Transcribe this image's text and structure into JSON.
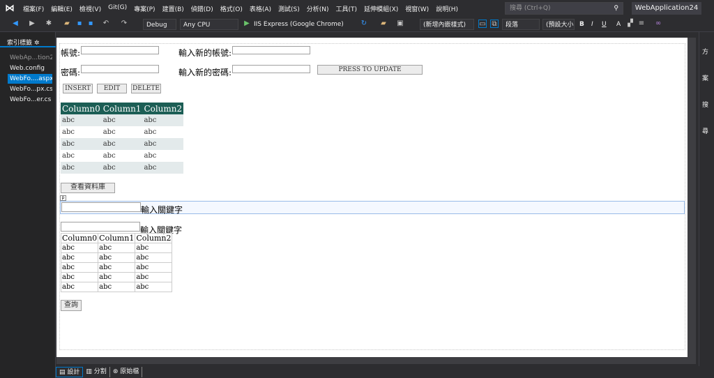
{
  "menubar": {
    "items": [
      "檔案(F)",
      "編輯(E)",
      "檢視(V)",
      "Git(G)",
      "專案(P)",
      "建置(B)",
      "偵錯(D)",
      "格式(O)",
      "表格(A)",
      "測試(S)",
      "分析(N)",
      "工具(T)",
      "延伸模組(X)",
      "視窗(W)",
      "說明(H)"
    ],
    "search_placeholder": "搜尋 (Ctrl+Q)",
    "solution_title": "WebApplication24"
  },
  "toolbar": {
    "config": "Debug",
    "platform": "Any CPU",
    "run_target": "IIS Express (Google Chrome)",
    "doc_mode": "(新增內嵌樣式)",
    "block_format": "段落",
    "font_size": "(預設大小)",
    "bold": "B",
    "italic": "I",
    "underline": "U",
    "font_color": "A"
  },
  "left_panel": {
    "title": "索引標籤",
    "items": [
      {
        "label": "WebAp...tion24",
        "kind": "project"
      },
      {
        "label": "Web.config",
        "kind": "file"
      },
      {
        "label": "WebFo....aspx",
        "kind": "selected"
      },
      {
        "label": "WebFo...px.cs",
        "kind": "file"
      },
      {
        "label": "WebFo...er.cs",
        "kind": "file"
      }
    ]
  },
  "right_panel": {
    "labels": [
      "方案",
      "搜尋"
    ]
  },
  "form": {
    "account_label": "帳號:",
    "new_account_label": "輸入新的帳號:",
    "password_label": "密碼:",
    "new_password_label": "輸入新的密碼:",
    "update_button": "PRESS TO UPDATE",
    "insert_button": "INSERT",
    "edit_button": "EDIT",
    "delete_button": "DELETE",
    "grid1": {
      "columns": [
        "Column0",
        "Column1",
        "Column2"
      ],
      "rows": [
        [
          "abc",
          "abc",
          "abc"
        ],
        [
          "abc",
          "abc",
          "abc"
        ],
        [
          "abc",
          "abc",
          "abc"
        ],
        [
          "abc",
          "abc",
          "abc"
        ],
        [
          "abc",
          "abc",
          "abc"
        ]
      ]
    },
    "view_db_button": "查看資料庫",
    "p_tag": "p",
    "keyword_label_1": "輸入關鍵字",
    "keyword_label_2": "輸入關鍵字",
    "grid2": {
      "columns": [
        "Column0",
        "Column1",
        "Column2"
      ],
      "rows": [
        [
          "abc",
          "abc",
          "abc"
        ],
        [
          "abc",
          "abc",
          "abc"
        ],
        [
          "abc",
          "abc",
          "abc"
        ],
        [
          "abc",
          "abc",
          "abc"
        ],
        [
          "abc",
          "abc",
          "abc"
        ]
      ]
    },
    "query_button": "查詢"
  },
  "bottom_tabs": [
    "設計",
    "分割",
    "原始檔"
  ]
}
